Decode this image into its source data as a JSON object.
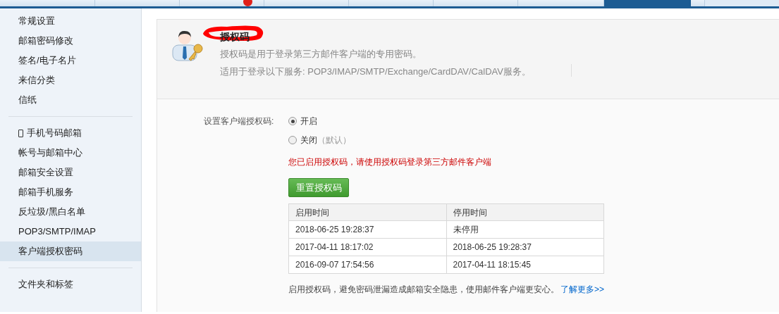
{
  "top_tabs": [
    {
      "selected": false,
      "badge": false
    },
    {
      "selected": false,
      "badge": false
    },
    {
      "selected": false,
      "badge": true
    },
    {
      "selected": false,
      "badge": false
    },
    {
      "selected": false,
      "badge": false
    },
    {
      "selected": false,
      "badge": false
    },
    {
      "selected": false,
      "badge": false
    },
    {
      "selected": true,
      "badge": false
    },
    {
      "selected": false,
      "badge": false
    }
  ],
  "sidebar": {
    "groups": [
      [
        {
          "label": "常规设置",
          "selected": false
        },
        {
          "label": "邮箱密码修改",
          "selected": false
        },
        {
          "label": "签名/电子名片",
          "selected": false
        },
        {
          "label": "来信分类",
          "selected": false
        },
        {
          "label": "信纸",
          "selected": false
        }
      ],
      [
        {
          "label": "手机号码邮箱",
          "selected": false,
          "kind": "phone"
        },
        {
          "label": "帐号与邮箱中心",
          "selected": false
        },
        {
          "label": "邮箱安全设置",
          "selected": false
        },
        {
          "label": "邮箱手机服务",
          "selected": false
        },
        {
          "label": "反垃圾/黑白名单",
          "selected": false
        },
        {
          "label": "POP3/SMTP/IMAP",
          "selected": false
        },
        {
          "label": "客户端授权密码",
          "selected": true
        }
      ],
      [
        {
          "label": "文件夹和标签",
          "selected": false
        }
      ]
    ]
  },
  "header": {
    "title": "授权码",
    "lines": [
      "授权码是用于登录第三方邮件客户端的专用密码。",
      "适用于登录以下服务: POP3/IMAP/SMTP/Exchange/CardDAV/CalDAV服务。"
    ]
  },
  "setting": {
    "label": "设置客户端授权码:",
    "options": [
      {
        "label": "开启",
        "selected": true
      },
      {
        "label": "关闭",
        "note": "（默认）",
        "selected": false
      }
    ]
  },
  "notice": "您已启用授权码，请使用授权码登录第三方邮件客户端",
  "reset_button": "重置授权码",
  "table": {
    "columns": [
      "启用时间",
      "停用时间"
    ],
    "rows": [
      [
        "2018-06-25 19:28:37",
        "未停用"
      ],
      [
        "2017-04-11 18:17:02",
        "2018-06-25 19:28:37"
      ],
      [
        "2016-09-07 17:54:56",
        "2017-04-11 18:15:45"
      ]
    ]
  },
  "footer": {
    "text": "启用授权码，避免密码泄漏造成邮箱安全隐患，使用邮件客户端更安心。",
    "link": "了解更多>>"
  }
}
